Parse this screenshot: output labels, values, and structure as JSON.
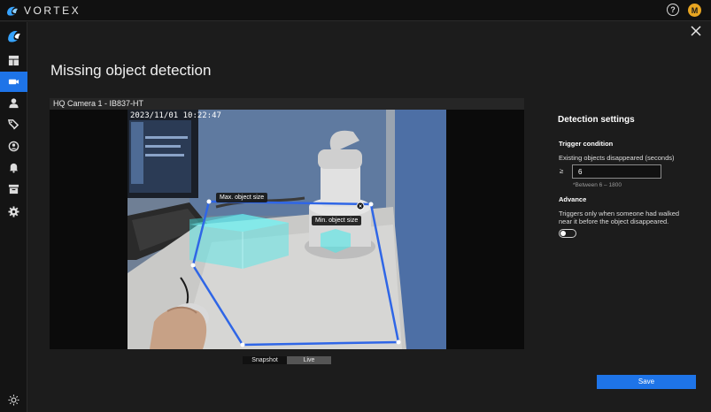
{
  "app": {
    "brand": "VORTEX",
    "help_icon": "?",
    "avatar_initial": "M",
    "accent_color": "#1e74e8",
    "avatar_color": "#e8a521"
  },
  "sidebar": {
    "items": [
      {
        "icon": "vortex-logo-icon",
        "active": false
      },
      {
        "icon": "dashboard-icon",
        "active": false
      },
      {
        "icon": "camera-icon",
        "active": true
      },
      {
        "icon": "user-icon",
        "active": false
      },
      {
        "icon": "tags-icon",
        "active": false
      },
      {
        "icon": "face-id-icon",
        "active": false
      },
      {
        "icon": "bell-icon",
        "active": false
      },
      {
        "icon": "archive-icon",
        "active": false
      },
      {
        "icon": "gear-icon",
        "active": false
      },
      {
        "icon": "brightness-icon",
        "active": false
      }
    ]
  },
  "page": {
    "title": "Missing object detection"
  },
  "video": {
    "camera_label": "HQ Camera 1 - IB837-HT",
    "timestamp": "2023/11/01 10:22:47",
    "max_label": "Max. object size",
    "min_label": "Min. object size",
    "snapshot_label": "Snapshot",
    "live_label": "Live",
    "selected_view": "Live"
  },
  "settings": {
    "title": "Detection settings",
    "trigger_title": "Trigger condition",
    "trigger_label": "Existing objects disappeared (seconds)",
    "operator": "≥",
    "seconds_value": "6",
    "range_hint": "*Between 6 – 1800",
    "advance_title": "Advance",
    "advance_line1": "Triggers only when someone had walked",
    "advance_line2": "near it before the object disappeared.",
    "advance_enabled": false
  },
  "actions": {
    "save_label": "Save"
  }
}
